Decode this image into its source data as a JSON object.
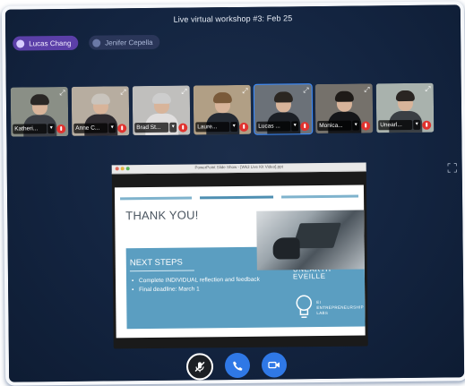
{
  "window": {
    "title": "Live virtual workshop #3: Feb 25"
  },
  "speakers": [
    {
      "name": "Lucas Chang",
      "active": true
    },
    {
      "name": "Jenifer Cepella",
      "active": false
    }
  ],
  "participants": [
    {
      "name": "Katheri...",
      "bg": "#8a8f86",
      "hair": "#2a2725",
      "body": "#3b3f46"
    },
    {
      "name": "Anne C...",
      "bg": "#b7ada0",
      "hair": "#c9c4bd",
      "body": "#2f2c31"
    },
    {
      "name": "Brad St...",
      "bg": "#c0bfbd",
      "hair": "#cdcdcd",
      "body": "#e0dede"
    },
    {
      "name": "Laure...",
      "bg": "#b19f85",
      "hair": "#7a5a3a",
      "body": "#242a33"
    },
    {
      "name": "Lucas ...",
      "bg": "#6b7178",
      "hair": "#2b2621",
      "body": "#1c2026",
      "active": true
    },
    {
      "name": "Monica...",
      "bg": "#75716b",
      "hair": "#1e1a17",
      "body": "#151619"
    },
    {
      "name": "Unearl...",
      "bg": "#a9b2ad",
      "hair": "#2a2522",
      "body": "#3a3f44"
    }
  ],
  "share": {
    "window_caption": "PowerPoint Slide Show - [Wk3 Live Kit Video].ppt",
    "slide": {
      "heading": "THANK YOU!",
      "section": "NEXT STEPS",
      "bullets": [
        "Complete INDIVIDUAL reflection and feedback",
        "Final deadline: March 1"
      ],
      "brand_line1": "UNEARTH",
      "brand_line2": "EVEILLE",
      "brand_sub1": "EI",
      "brand_sub2": "ENTREPRENEURSHIP",
      "brand_sub3": "LABS"
    }
  },
  "icons": {
    "expand": "expand-icon",
    "fullscreen": "fullscreen-icon",
    "mute": "mic-off-icon",
    "call": "phone-icon",
    "video": "video-camera-icon"
  },
  "colors": {
    "background": "#132440",
    "accent": "#2f78e6",
    "speaker_active": "#5b3fa8",
    "mic_off": "#e0332f",
    "slide_panel": "#5b9ec1"
  }
}
